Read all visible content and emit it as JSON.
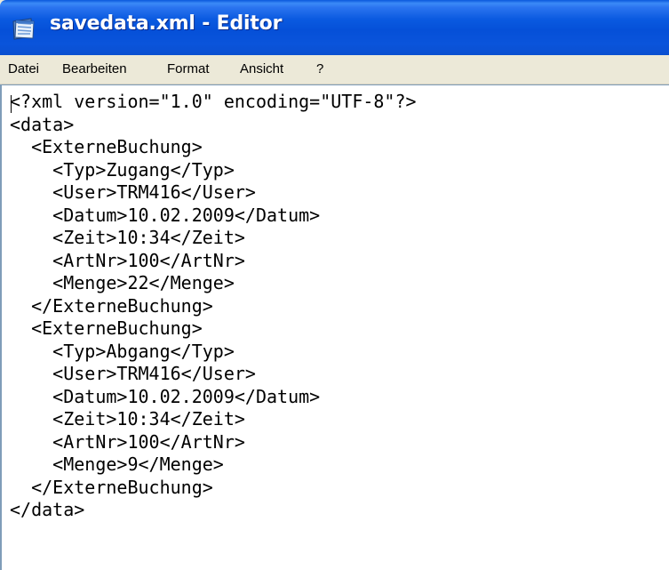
{
  "window": {
    "title": "savedata.xml - Editor",
    "icon": "notepad-icon"
  },
  "menu": {
    "items": [
      {
        "label": "Datei"
      },
      {
        "label": "Bearbeiten"
      },
      {
        "label": "Format"
      },
      {
        "label": "Ansicht"
      },
      {
        "label": "?"
      }
    ]
  },
  "editor": {
    "lines": [
      "<?xml version=\"1.0\" encoding=\"UTF-8\"?>",
      "<data>",
      "  <ExterneBuchung>",
      "    <Typ>Zugang</Typ>",
      "    <User>TRM416</User>",
      "    <Datum>10.02.2009</Datum>",
      "    <Zeit>10:34</Zeit>",
      "    <ArtNr>100</ArtNr>",
      "    <Menge>22</Menge>",
      "  </ExterneBuchung>",
      "  <ExterneBuchung>",
      "    <Typ>Abgang</Typ>",
      "    <User>TRM416</User>",
      "    <Datum>10.02.2009</Datum>",
      "    <Zeit>10:34</Zeit>",
      "    <ArtNr>100</ArtNr>",
      "    <Menge>9</Menge>",
      "  </ExterneBuchung>",
      "</data>"
    ]
  },
  "colors": {
    "titlebar": "#0a54db",
    "title_text": "#ffffff",
    "menubar": "#ece9d8",
    "editor_background": "#ffffff",
    "editor_border": "#7f9db9"
  }
}
